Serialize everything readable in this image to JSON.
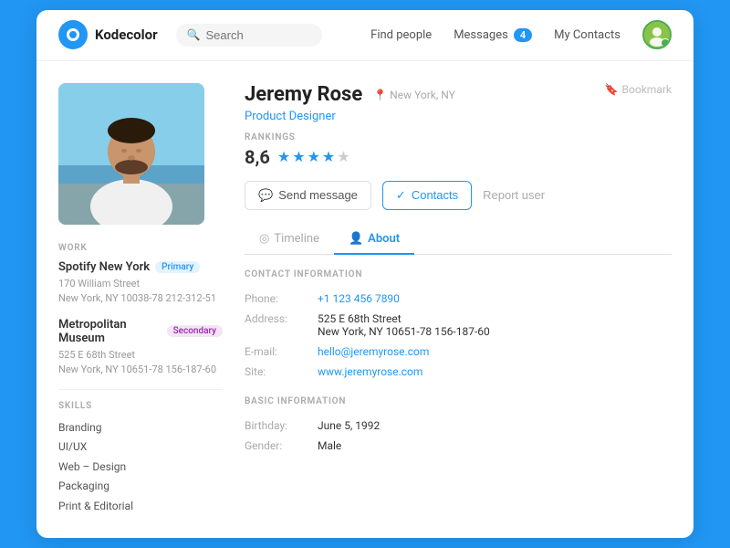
{
  "app": {
    "name": "Kodecolor"
  },
  "header": {
    "search_placeholder": "Search",
    "nav": {
      "find_people": "Find people",
      "messages": "Messages",
      "messages_count": "4",
      "my_contacts": "My Contacts"
    }
  },
  "profile": {
    "name": "Jeremy Rose",
    "location": "New York, NY",
    "job_title": "Product Designer",
    "bookmark_label": "Bookmark",
    "rankings_label": "RANKINGS",
    "rating_number": "8,6",
    "actions": {
      "send_message": "Send message",
      "contacts": "Contacts",
      "report_user": "Report user"
    },
    "tabs": {
      "timeline": "Timeline",
      "about": "About"
    },
    "work": {
      "label": "WORK",
      "items": [
        {
          "name": "Spotify New York",
          "tag": "Primary",
          "tag_type": "primary",
          "address_line1": "170 William Street",
          "address_line2": "New York, NY 10038-78 212-312-51"
        },
        {
          "name": "Metropolitan Museum",
          "tag": "Secondary",
          "tag_type": "secondary",
          "address_line1": "525 E 68th Street",
          "address_line2": "New York, NY 10651-78 156-187-60"
        }
      ]
    },
    "skills": {
      "label": "SKILLS",
      "items": [
        "Branding",
        "UI/UX",
        "Web – Design",
        "Packaging",
        "Print & Editorial"
      ]
    },
    "contact_info": {
      "label": "CONTACT INFORMATION",
      "phone_label": "Phone:",
      "phone_value": "+1 123 456 7890",
      "address_label": "Address:",
      "address_line1": "525 E 68th Street",
      "address_line2": "New York, NY 10651-78 156-187-60",
      "email_label": "E-mail:",
      "email_value": "hello@jeremyrose.com",
      "site_label": "Site:",
      "site_value": "www.jeremyrose.com"
    },
    "basic_info": {
      "label": "BASIC INFORMATION",
      "birthday_label": "Birthday:",
      "birthday_value": "June 5, 1992",
      "gender_label": "Gender:",
      "gender_value": "Male"
    }
  }
}
